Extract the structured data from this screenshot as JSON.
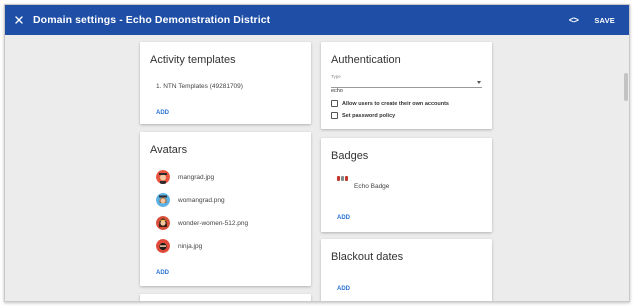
{
  "header": {
    "title": "Domain settings - Echo Demonstration District",
    "close_icon": "close-icon",
    "code_label": "<>",
    "save_label": "SAVE"
  },
  "activity_templates": {
    "title": "Activity templates",
    "items": [
      "1. NTN Templates (49281709)"
    ],
    "add_label": "ADD"
  },
  "avatars": {
    "title": "Avatars",
    "items": [
      {
        "name": "mangrad.jpg",
        "icon": "graduate-man-avatar"
      },
      {
        "name": "womangrad.png",
        "icon": "graduate-woman-avatar"
      },
      {
        "name": "wonder-women-512.png",
        "icon": "wonder-woman-avatar"
      },
      {
        "name": "ninja.jpg",
        "icon": "ninja-avatar"
      }
    ],
    "add_label": "ADD"
  },
  "authentication": {
    "title": "Authentication",
    "type_label": "Type",
    "type_value": "echo",
    "options": [
      {
        "label": "Allow users to create their own accounts",
        "checked": false
      },
      {
        "label": "Set password policy",
        "checked": false
      }
    ]
  },
  "badges": {
    "title": "Badges",
    "items": [
      {
        "name": "Echo Badge",
        "icon": "echo-badge-icon"
      }
    ],
    "add_label": "ADD"
  },
  "blackout_dates": {
    "title": "Blackout dates",
    "add_label": "ADD"
  },
  "colors": {
    "appbar": "#1e4ea6",
    "accent_link": "#2a73d9",
    "background": "#ececec"
  }
}
